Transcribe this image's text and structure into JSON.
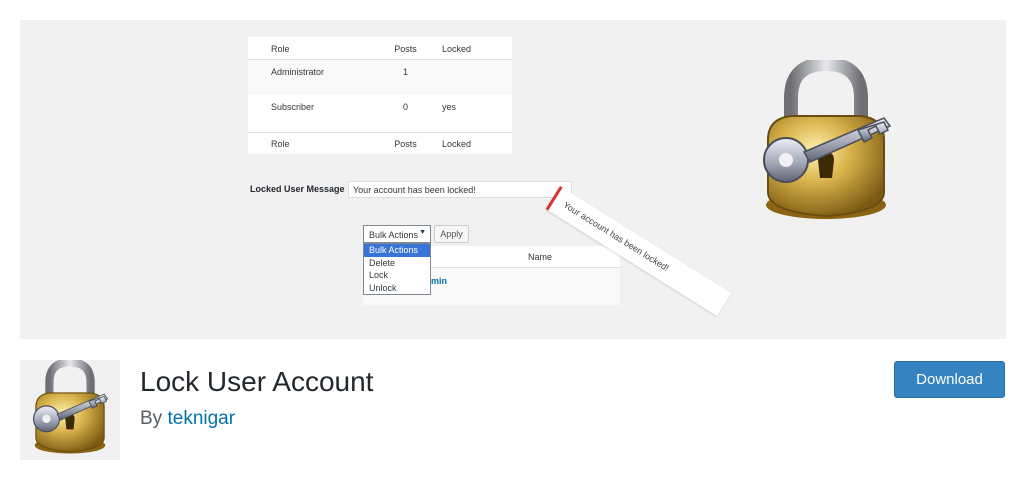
{
  "banner": {
    "roles_table": {
      "header": {
        "role": "Role",
        "posts": "Posts",
        "locked": "Locked"
      },
      "rows": [
        {
          "role": "Administrator",
          "posts": "1",
          "locked": ""
        },
        {
          "role": "Subscriber",
          "posts": "0",
          "locked": "yes"
        }
      ],
      "footer": {
        "role": "Role",
        "posts": "Posts",
        "locked": "Locked"
      }
    },
    "locked_message": {
      "label": "Locked User Message",
      "value": "Your account has been locked!"
    },
    "bulk_actions": {
      "selected": "Bulk Actions",
      "options": [
        "Bulk Actions",
        "Delete",
        "Lock",
        "Unlock"
      ],
      "apply_label": "Apply"
    },
    "users_table": {
      "column_name": "Name",
      "username_fragment": "min"
    },
    "notice_text": "Your account has been locked!"
  },
  "plugin": {
    "title": "Lock User Account",
    "by_label": "By",
    "author": "teknigar",
    "download_label": "Download"
  },
  "colors": {
    "accent": "#0073aa",
    "download": "#3584c1",
    "notice_border": "#dc3232",
    "lock_gold": "#c9a227"
  },
  "icons": {
    "banner_art": "padlock-with-key-icon",
    "plugin_icon": "padlock-with-key-icon"
  }
}
